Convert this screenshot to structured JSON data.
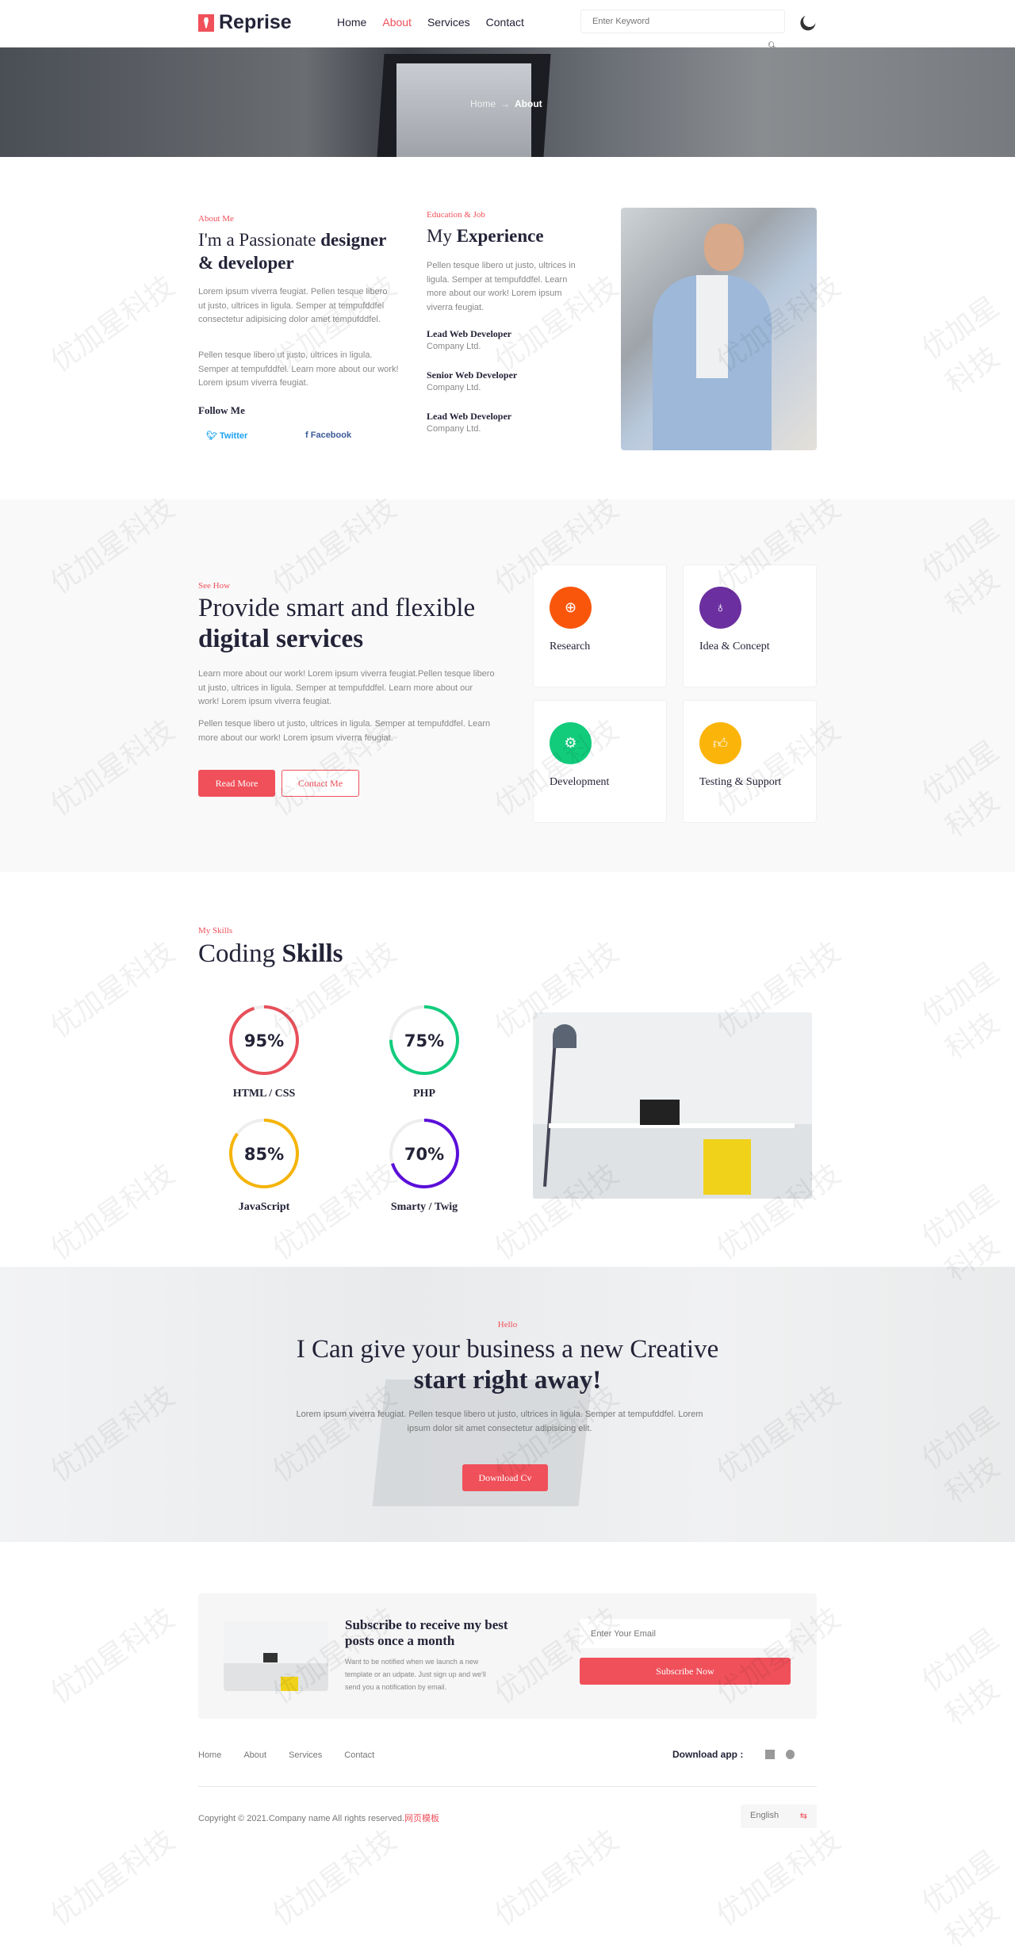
{
  "header": {
    "logo": "Reprise",
    "nav": [
      "Home",
      "About",
      "Services",
      "Contact"
    ],
    "active": "About",
    "search_placeholder": "Enter Keyword"
  },
  "banner": {
    "crumb_home": "Home",
    "crumb_arrow": "→",
    "crumb_current": "About"
  },
  "about": {
    "sub": "About Me",
    "title_light": "I'm a Passionate ",
    "title_bold": "designer & developer",
    "p1": "Lorem ipsum viverra feugiat. Pellen tesque libero ut justo, ultrices in ligula. Semper at tempufddfel consectetur adipisicing dolor amet tempufddfel.",
    "p2": "Pellen tesque libero ut justo, ultrices in ligula. Semper at tempufddfel. Learn more about our work! Lorem ipsum viverra feugiat.",
    "follow": "Follow Me",
    "twitter": "Twitter",
    "facebook": "Facebook"
  },
  "experience": {
    "sub": "Education & Job",
    "title_light": "My ",
    "title_bold": "Experience",
    "p": "Pellen tesque libero ut justo, ultrices in ligula. Semper at tempufddfel. Learn more about our work! Lorem ipsum viverra feugiat.",
    "jobs": [
      {
        "title": "Lead Web Developer",
        "company": "Company Ltd."
      },
      {
        "title": "Senior Web Developer",
        "company": "Company Ltd."
      },
      {
        "title": "Lead Web Developer",
        "company": "Company Ltd."
      }
    ]
  },
  "services": {
    "sub": "See How",
    "title_light": "Provide smart and flexible",
    "title_bold": "digital services",
    "p1": "Learn more about our work! Lorem ipsum viverra feugiat.Pellen tesque libero ut justo, ultrices in ligula. Semper at tempufddfel. Learn more about our work! Lorem ipsum viverra feugiat.",
    "p2": "Pellen tesque libero ut justo, ultrices in ligula. Semper at tempufddfel. Learn more about our work! Lorem ipsum viverra feugiat.",
    "read_more": "Read More",
    "contact": "Contact Me",
    "cards": [
      {
        "title": "Research",
        "icon": "search-plus-icon",
        "color": "#f9560c"
      },
      {
        "title": "Idea & Concept",
        "icon": "lightbulb-icon",
        "color": "#6b2fa0"
      },
      {
        "title": "Development",
        "icon": "code-icon",
        "color": "#12cc7c"
      },
      {
        "title": "Testing & Support",
        "icon": "thumbs-up-icon",
        "color": "#fbb40a"
      }
    ]
  },
  "skills": {
    "sub": "My Skills",
    "title_light": "Coding ",
    "title_bold": "Skills",
    "items": [
      {
        "label": "HTML / CSS",
        "percent": 95,
        "pct_text": "95%",
        "color": "#e8505b"
      },
      {
        "label": "PHP",
        "percent": 75,
        "pct_text": "75%",
        "color": "#12cc7c"
      },
      {
        "label": "JavaScript",
        "percent": 85,
        "pct_text": "85%",
        "color": "#f5b40a"
      },
      {
        "label": "Smarty / Twig",
        "percent": 70,
        "pct_text": "70%",
        "color": "#5b0fd9"
      }
    ]
  },
  "cta": {
    "sub": "Hello",
    "title_light": "I Can give your business a new Creative",
    "title_bold": "start right away!",
    "p": "Lorem ipsum viverra feugiat. Pellen tesque libero ut justo, ultrices in ligula. Semper at tempufddfel. Lorem ipsum dolor sit amet consectetur adipisicing elit.",
    "button": "Download Cv"
  },
  "subscribe": {
    "title": "Subscribe to receive my best posts once a month",
    "p": "Want to be notified when we launch a new template or an udpate. Just sign up and we'll send you a notification by email.",
    "email_placeholder": "Enter Your Email",
    "button": "Subscribe Now"
  },
  "footer": {
    "nav": [
      "Home",
      "About",
      "Services",
      "Contact"
    ],
    "download": "Download app :",
    "copyright": "Copyright © 2021.Company name All rights reserved.",
    "copyright_link": "网页模板",
    "language": "English"
  },
  "watermark": "优加星科技",
  "colors": {
    "accent": "#f0505a",
    "dark": "#232338"
  }
}
